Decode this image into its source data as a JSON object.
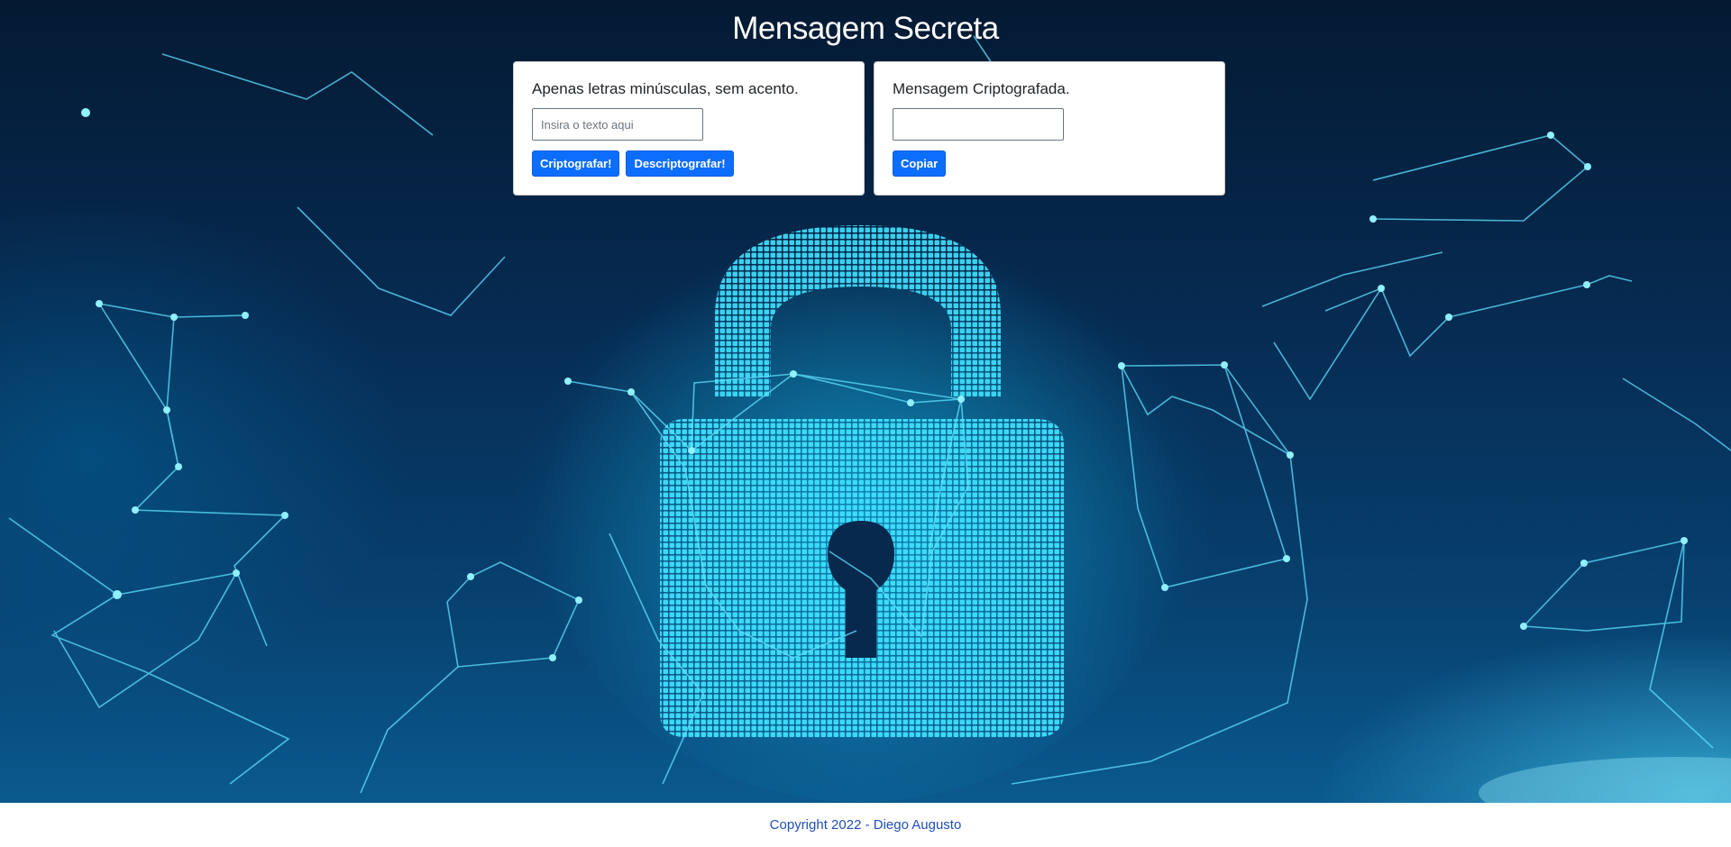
{
  "header": {
    "title": "Mensagem Secreta"
  },
  "encrypt_card": {
    "label": "Apenas letras minúsculas, sem acento.",
    "input_placeholder": "Insira o texto aqui",
    "input_value": "",
    "encrypt_button": "Criptografar!",
    "decrypt_button": "Descriptografar!"
  },
  "result_card": {
    "label": "Mensagem Criptografada.",
    "output_value": "",
    "copy_button": "Copiar"
  },
  "footer": {
    "copyright": "Copyright 2022 - Diego Augusto"
  },
  "colors": {
    "primary_button": "#0d6efd",
    "footer_text": "#1f4fb8",
    "hero_glow": "#35d6f0"
  }
}
